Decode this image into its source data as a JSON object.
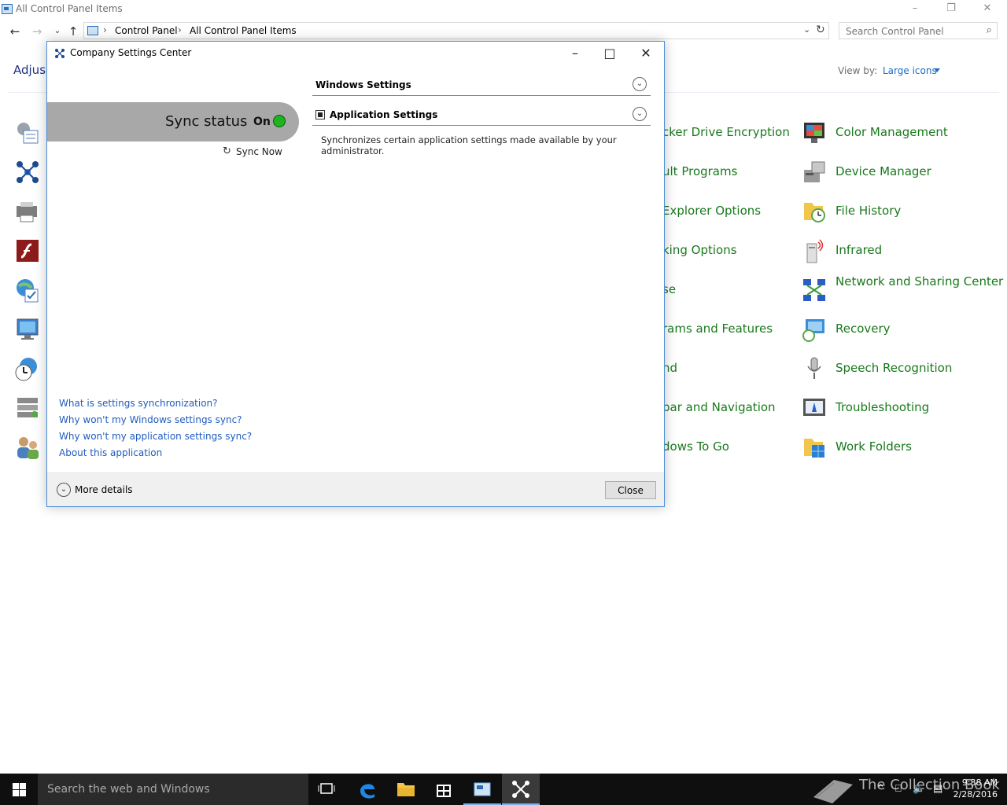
{
  "control_panel": {
    "window_title": "All Control Panel Items",
    "breadcrumbs": [
      "Control Panel",
      "All Control Panel Items"
    ],
    "search_placeholder": "Search Control Panel",
    "adjust_heading": "Adjus",
    "view_by_label": "View by:",
    "view_by_value": "Large icons",
    "middle_items": [
      "cker Drive Encryption",
      "ult Programs",
      "Explorer Options",
      "king Options",
      "se",
      "rams and Features",
      "nd",
      "bar and Navigation",
      "dows To Go"
    ],
    "right_items": [
      "Color Management",
      "Device Manager",
      "File History",
      "Infrared",
      "Network and Sharing Center",
      "Recovery",
      "Speech Recognition",
      "Troubleshooting",
      "Work Folders"
    ]
  },
  "dialog": {
    "title": "Company Settings Center",
    "sync_status_label": "Sync status",
    "sync_status_value": "On",
    "sync_now_label": "Sync Now",
    "sections": [
      {
        "title": "Windows Settings"
      },
      {
        "title": "Application Settings",
        "description": "Synchronizes certain application settings made available by your administrator."
      }
    ],
    "links": [
      "What is settings synchronization?",
      "Why won't my Windows settings sync?",
      "Why won't my application settings sync?",
      "About this application"
    ],
    "more_details_label": "More details",
    "close_label": "Close"
  },
  "taskbar": {
    "search_placeholder": "Search the web and Windows",
    "time": "9:38 AM",
    "date": "2/28/2016",
    "watermark": "The Collection Book"
  },
  "colors": {
    "link_green": "#19791c",
    "link_blue": "#1e5cbf",
    "sync_on": "#1fb31f"
  }
}
